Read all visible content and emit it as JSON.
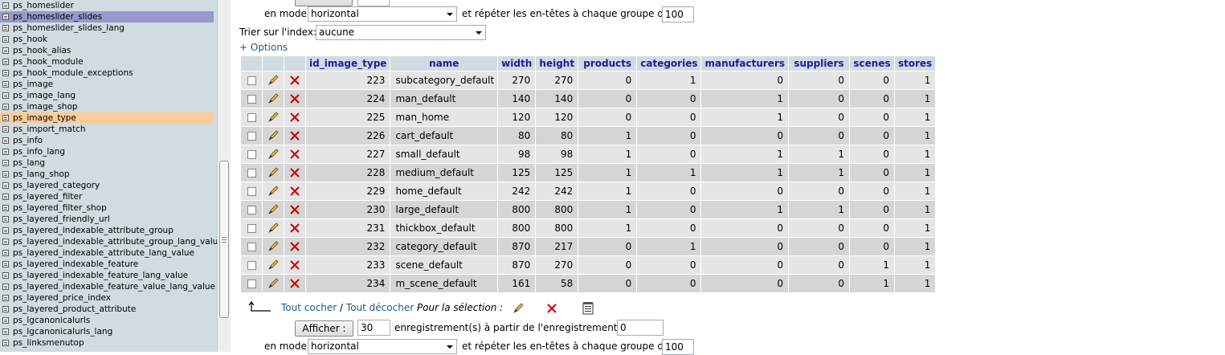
{
  "sidebar": {
    "items": [
      "ps_homeslider",
      "ps_homeslider_slides",
      "ps_homeslider_slides_lang",
      "ps_hook",
      "ps_hook_alias",
      "ps_hook_module",
      "ps_hook_module_exceptions",
      "ps_image",
      "ps_image_lang",
      "ps_image_shop",
      "ps_image_type",
      "ps_import_match",
      "ps_info",
      "ps_info_lang",
      "ps_lang",
      "ps_lang_shop",
      "ps_layered_category",
      "ps_layered_filter",
      "ps_layered_filter_shop",
      "ps_layered_friendly_url",
      "ps_layered_indexable_attribute_group",
      "ps_layered_indexable_attribute_group_lang_value",
      "ps_layered_indexable_attribute_lang_value",
      "ps_layered_indexable_feature",
      "ps_layered_indexable_feature_lang_value",
      "ps_layered_indexable_feature_value_lang_value",
      "ps_layered_price_index",
      "ps_layered_product_attribute",
      "ps_lgcanonicalurls",
      "ps_lgcanonicalurls_lang",
      "ps_linksmenutop"
    ],
    "selected_blue": "ps_homeslider_slides",
    "selected_orange": "ps_image_type"
  },
  "top_nav": {
    "mode_label": "en mode",
    "mode_value": "horizontal",
    "repeat_label": "et répéter les en-têtes à chaque groupe de",
    "repeat_value": "100"
  },
  "sort": {
    "label": "Trier sur l'index:",
    "value": "aucune"
  },
  "options_link": "+ Options",
  "table": {
    "columns": [
      "id_image_type",
      "name",
      "width",
      "height",
      "products",
      "categories",
      "manufacturers",
      "suppliers",
      "scenes",
      "stores"
    ],
    "rows": [
      [
        "223",
        "subcategory_default",
        "270",
        "270",
        "0",
        "1",
        "0",
        "0",
        "0",
        "1"
      ],
      [
        "224",
        "man_default",
        "140",
        "140",
        "0",
        "0",
        "1",
        "0",
        "0",
        "1"
      ],
      [
        "225",
        "man_home",
        "120",
        "120",
        "0",
        "0",
        "1",
        "0",
        "0",
        "1"
      ],
      [
        "226",
        "cart_default",
        "80",
        "80",
        "1",
        "0",
        "0",
        "0",
        "0",
        "1"
      ],
      [
        "227",
        "small_default",
        "98",
        "98",
        "1",
        "0",
        "1",
        "1",
        "0",
        "1"
      ],
      [
        "228",
        "medium_default",
        "125",
        "125",
        "1",
        "1",
        "1",
        "1",
        "0",
        "1"
      ],
      [
        "229",
        "home_default",
        "242",
        "242",
        "1",
        "0",
        "0",
        "0",
        "0",
        "1"
      ],
      [
        "230",
        "large_default",
        "800",
        "800",
        "1",
        "0",
        "1",
        "1",
        "0",
        "1"
      ],
      [
        "231",
        "thickbox_default",
        "800",
        "800",
        "1",
        "0",
        "0",
        "0",
        "0",
        "1"
      ],
      [
        "232",
        "category_default",
        "870",
        "217",
        "0",
        "1",
        "0",
        "0",
        "0",
        "1"
      ],
      [
        "233",
        "scene_default",
        "870",
        "270",
        "0",
        "0",
        "0",
        "0",
        "1",
        "1"
      ],
      [
        "234",
        "m_scene_default",
        "161",
        "58",
        "0",
        "0",
        "0",
        "0",
        "1",
        "1"
      ]
    ]
  },
  "selection": {
    "check_all": "Tout cocher",
    "separator": "/",
    "uncheck_all": "Tout décocher",
    "for_selection": "Pour la sélection :"
  },
  "bottom_nav": {
    "show_button": "Afficher :",
    "count_value": "30",
    "records_label": "enregistrement(s) à partir de l'enregistrement n°",
    "start_value": "0",
    "mode_label": "en mode",
    "mode_value": "horizontal",
    "repeat_label": "et répéter les en-têtes à chaque groupe de",
    "repeat_value": "100"
  },
  "colors": {
    "sidebar_bg": "#d0dce0",
    "sidebar_selected": "#9999cc",
    "sidebar_marked": "#ffcc99",
    "header_text": "#1b1ba0",
    "row_odd": "#e5e5e5",
    "row_even": "#d5d5d5",
    "link": "#235a81",
    "delete_icon": "#cc0000"
  }
}
